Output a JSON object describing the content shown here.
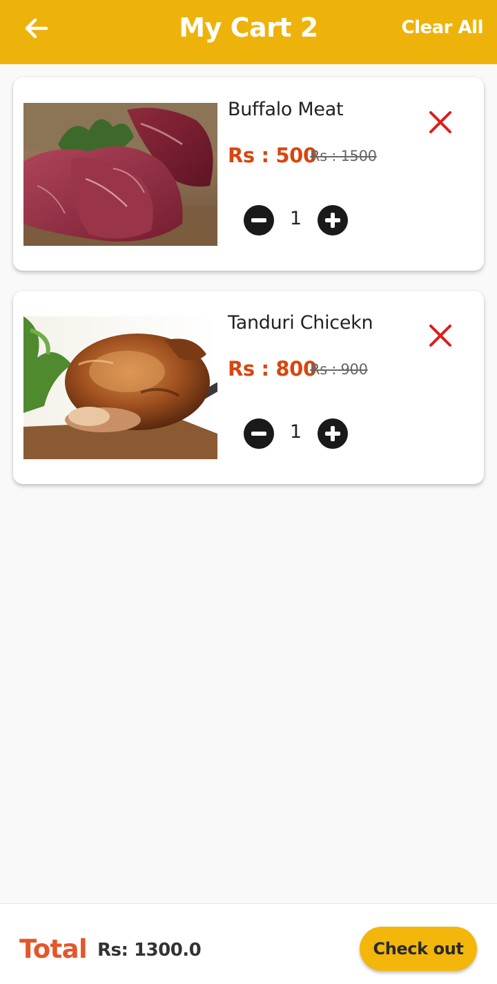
{
  "header": {
    "title": "My Cart 2",
    "clear_all_label": "Clear All",
    "background_color": "#eeb30a"
  },
  "cart_items": [
    {
      "name": "Buffalo Meat",
      "price": "Rs : 500",
      "original_price": "Rs : 1500",
      "quantity": "1"
    },
    {
      "name": "Tanduri Chicekn",
      "price": "Rs : 800",
      "original_price": "Rs : 900",
      "quantity": "1"
    }
  ],
  "footer": {
    "total_label": "Total",
    "total_value": "Rs: 1300.0",
    "checkout_label": "Check out"
  },
  "colors": {
    "accent": "#eeb30a",
    "price": "#d9450f",
    "remove": "#e01b1b",
    "total": "#e4562a"
  },
  "icons": [
    "back-arrow-icon",
    "close-icon",
    "minus-circle-icon",
    "plus-circle-icon"
  ]
}
